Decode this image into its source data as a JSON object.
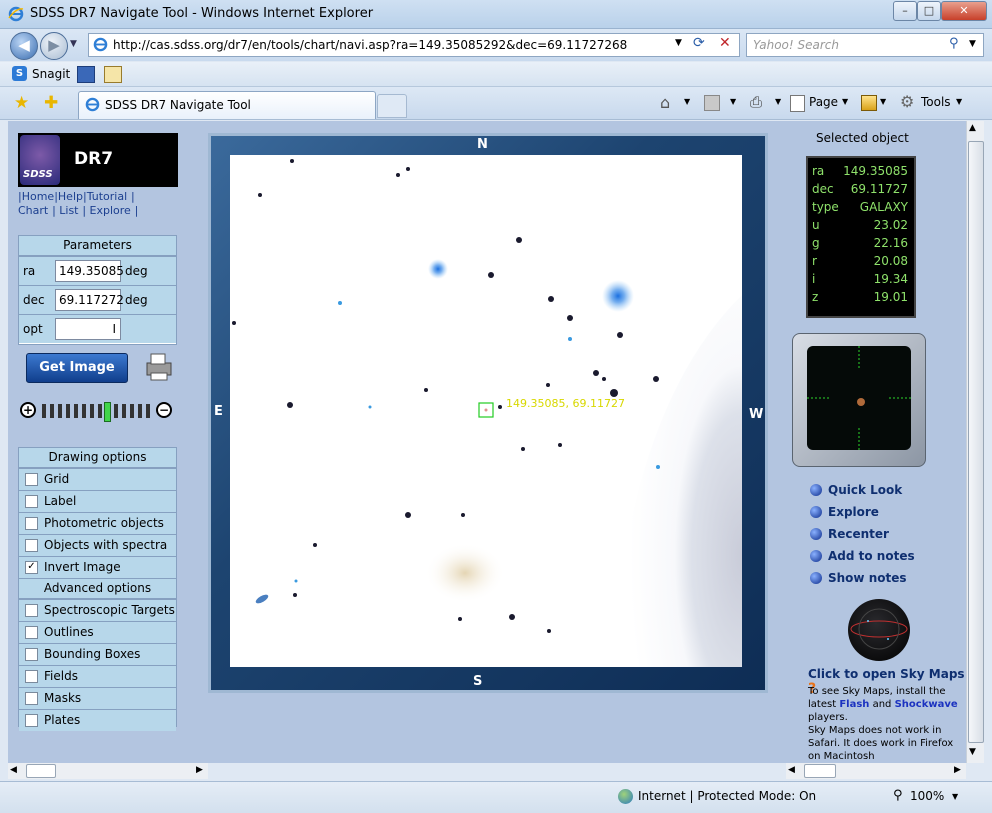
{
  "window": {
    "title": "SDSS DR7 Navigate Tool - Windows Internet Explorer",
    "minimize": "–",
    "maximize": "□",
    "close": "✕"
  },
  "address": {
    "url": "http://cas.sdss.org/dr7/en/tools/chart/navi.asp?ra=149.35085292&dec=69.11727268"
  },
  "search": {
    "placeholder": "Yahoo! Search"
  },
  "links_bar": {
    "snagit": "Snagit"
  },
  "tab": {
    "label": "SDSS DR7 Navigate Tool"
  },
  "command_bar": {
    "page": "Page",
    "tools": "Tools"
  },
  "left": {
    "logo_text": "DR7",
    "logo_sub": "SDSS",
    "links1": [
      "|Home",
      "|Help",
      "|Tutorial",
      "|"
    ],
    "links2": [
      "Chart",
      "| List",
      "| Explore",
      "|"
    ],
    "params": {
      "title": "Parameters",
      "ra_label": "ra",
      "ra_value": "149.35085",
      "ra_unit": "deg",
      "dec_label": "dec",
      "dec_value": "69.117272",
      "dec_unit": "deg",
      "opt_label": "opt",
      "opt_value": "I"
    },
    "get_image": "Get Image",
    "zoom_level": 0.6,
    "drawing_title": "Drawing options",
    "drawing": [
      {
        "label": "Grid",
        "checked": false
      },
      {
        "label": "Label",
        "checked": false
      },
      {
        "label": "Photometric objects",
        "checked": false
      },
      {
        "label": "Objects with spectra",
        "checked": false
      },
      {
        "label": "Invert Image",
        "checked": true
      }
    ],
    "advanced_title": "Advanced options",
    "advanced": [
      {
        "label": "Spectroscopic Targets",
        "checked": false
      },
      {
        "label": "Outlines",
        "checked": false
      },
      {
        "label": "Bounding Boxes",
        "checked": false
      },
      {
        "label": "Fields",
        "checked": false
      },
      {
        "label": "Masks",
        "checked": false
      },
      {
        "label": "Plates",
        "checked": false
      }
    ]
  },
  "map": {
    "north": "N",
    "south": "S",
    "east": "E",
    "west": "W",
    "marker_label": "149.35085, 69.11727"
  },
  "right": {
    "selected_title": "Selected object",
    "object": [
      {
        "k": "ra",
        "v": "149.35085"
      },
      {
        "k": "dec",
        "v": "69.11727"
      },
      {
        "k": "type",
        "v": "GALAXY"
      },
      {
        "k": "u",
        "v": "23.02"
      },
      {
        "k": "g",
        "v": "22.16"
      },
      {
        "k": "r",
        "v": "20.08"
      },
      {
        "k": "i",
        "v": "19.34"
      },
      {
        "k": "z",
        "v": "19.01"
      }
    ],
    "links": [
      "Quick Look",
      "Explore",
      "Recenter",
      "Add to notes",
      "Show notes"
    ],
    "skymaps_title": "Click to open Sky Maps",
    "skymaps_q": "?",
    "note1a": "To see Sky Maps, install the",
    "note1b": "latest",
    "flash": "Flash",
    "and": "and",
    "shockwave": "Shockwave",
    "note1c": "players.",
    "note2": "Sky Maps does not work in",
    "note3": "Safari. It does work in Firefox",
    "note4": "on Macintosh"
  },
  "status": {
    "zone": "Internet | Protected Mode: On",
    "zoom": "100%"
  }
}
